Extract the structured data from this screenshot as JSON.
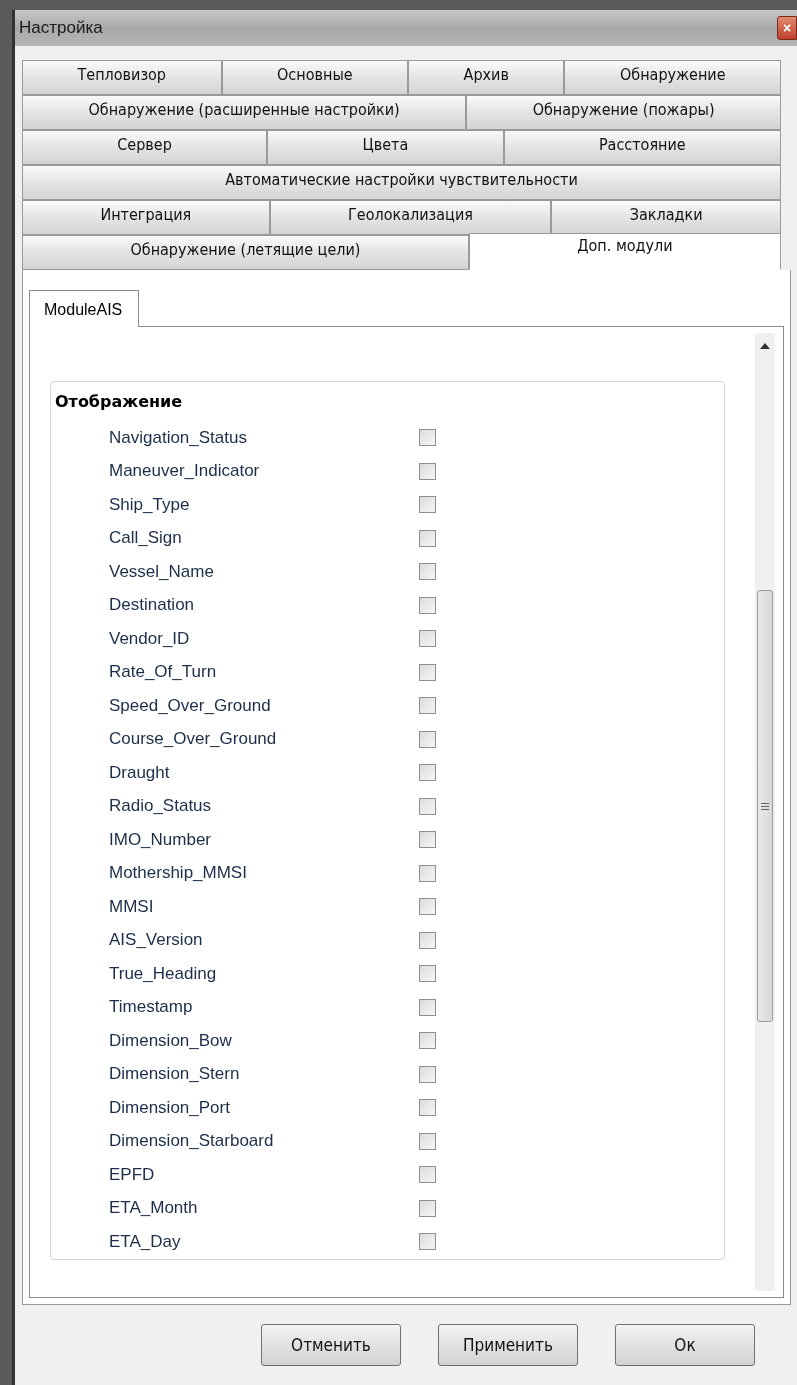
{
  "window": {
    "title": "Настройка",
    "close": "×"
  },
  "tab_rows": [
    [
      {
        "label": "Тепловизор",
        "selected": false
      },
      {
        "label": "Основные",
        "selected": false
      },
      {
        "label": "Архив",
        "selected": false
      },
      {
        "label": "Обнаружение",
        "selected": false
      }
    ],
    [
      {
        "label": "Обнаружение (расширенные настройки)",
        "selected": false
      },
      {
        "label": "Обнаружение (пожары)",
        "selected": false
      }
    ],
    [
      {
        "label": "Сервер",
        "selected": false
      },
      {
        "label": "Цвета",
        "selected": false
      },
      {
        "label": "Расстояние",
        "selected": false
      }
    ],
    [
      {
        "label": "Автоматические настройки чувствительности",
        "selected": false
      }
    ],
    [
      {
        "label": "Интеграция",
        "selected": false
      },
      {
        "label": "Геолокализация",
        "selected": false
      },
      {
        "label": "Закладки",
        "selected": false
      }
    ],
    [
      {
        "label": "Обнаружение (летящие цели)",
        "selected": false
      },
      {
        "label": "Доп. модули",
        "selected": true
      }
    ]
  ],
  "module_tabs": [
    {
      "label": "ModuleAIS",
      "selected": true
    }
  ],
  "group": {
    "title": "Отображение",
    "items": [
      {
        "label": "Navigation_Status",
        "checked": false
      },
      {
        "label": "Maneuver_Indicator",
        "checked": false
      },
      {
        "label": "Ship_Type",
        "checked": false
      },
      {
        "label": "Call_Sign",
        "checked": false
      },
      {
        "label": "Vessel_Name",
        "checked": false
      },
      {
        "label": "Destination",
        "checked": false
      },
      {
        "label": "Vendor_ID",
        "checked": false
      },
      {
        "label": "Rate_Of_Turn",
        "checked": false
      },
      {
        "label": "Speed_Over_Ground",
        "checked": false
      },
      {
        "label": "Course_Over_Ground",
        "checked": false
      },
      {
        "label": "Draught",
        "checked": false
      },
      {
        "label": "Radio_Status",
        "checked": false
      },
      {
        "label": "IMO_Number",
        "checked": false
      },
      {
        "label": "Mothership_MMSI",
        "checked": false
      },
      {
        "label": "MMSI",
        "checked": false
      },
      {
        "label": "AIS_Version",
        "checked": false
      },
      {
        "label": "True_Heading",
        "checked": false
      },
      {
        "label": "Timestamp",
        "checked": false
      },
      {
        "label": "Dimension_Bow",
        "checked": false
      },
      {
        "label": "Dimension_Stern",
        "checked": false
      },
      {
        "label": "Dimension_Port",
        "checked": false
      },
      {
        "label": "Dimension_Starboard",
        "checked": false
      },
      {
        "label": "EPFD",
        "checked": false
      },
      {
        "label": "ETA_Month",
        "checked": false
      },
      {
        "label": "ETA_Day",
        "checked": false
      }
    ]
  },
  "buttons": [
    "Отменить",
    "Применить",
    "Ок"
  ]
}
